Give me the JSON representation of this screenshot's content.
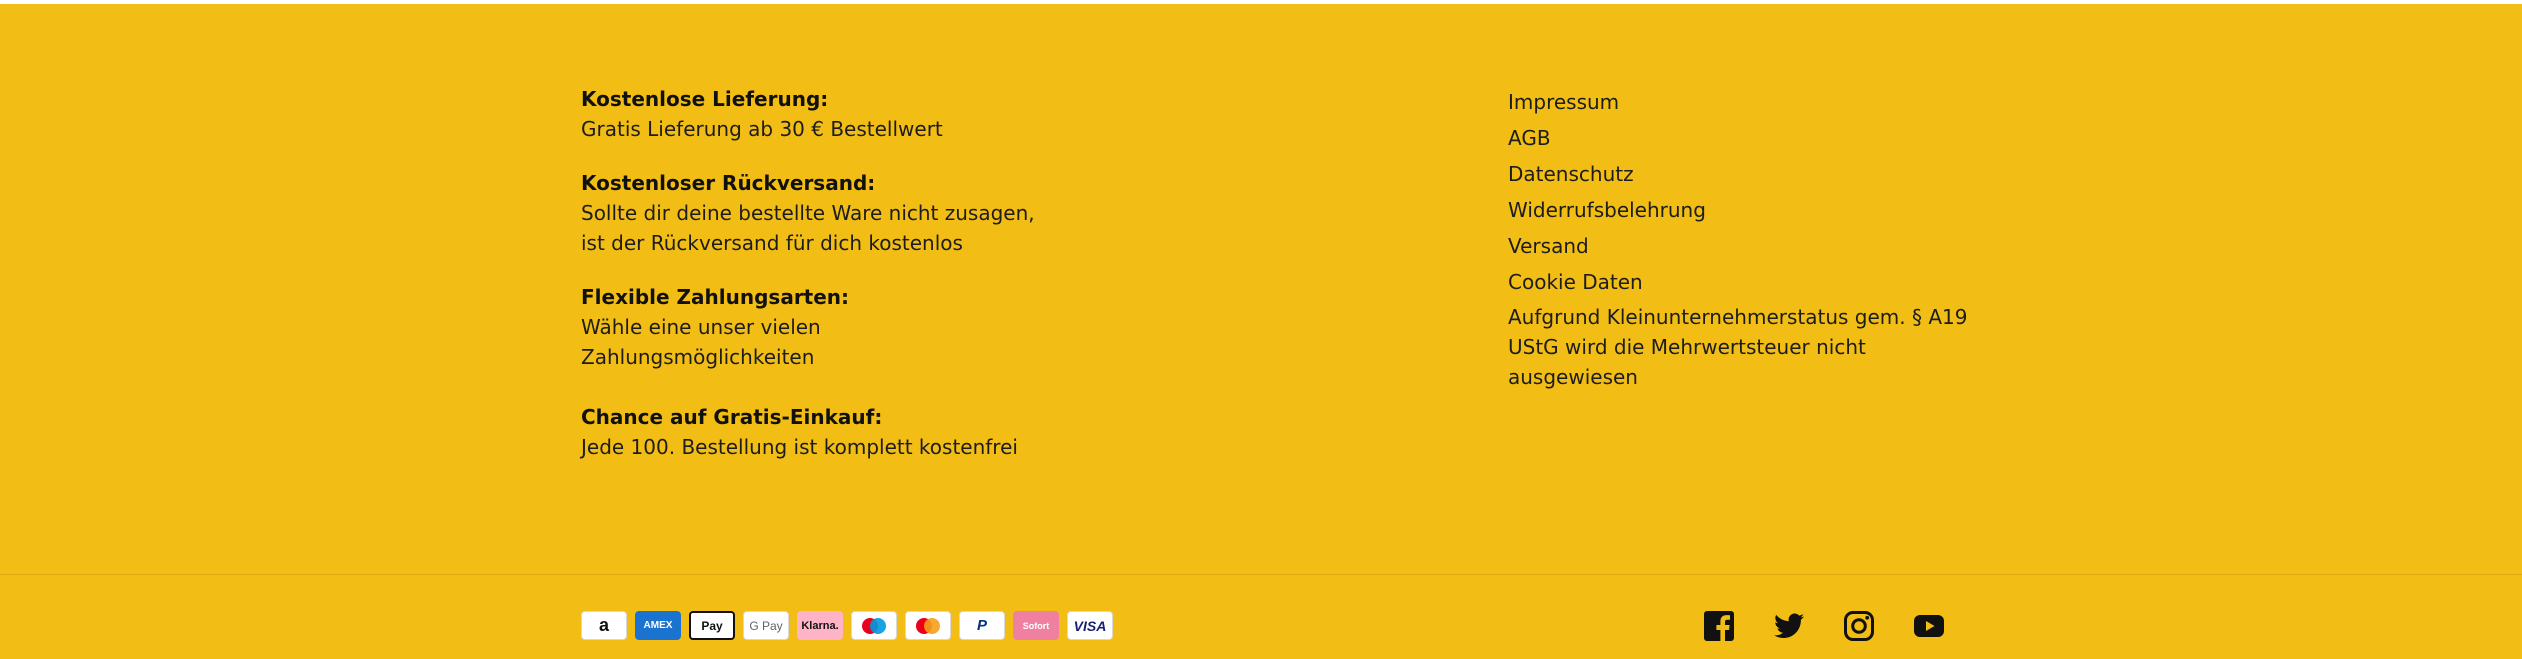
{
  "info": [
    {
      "title": "Kostenlose Lieferung:",
      "lines": [
        "Gratis Lieferung ab 30 € Bestellwert"
      ]
    },
    {
      "title": "Kostenloser Rückversand:",
      "lines": [
        "Sollte dir deine bestellte Ware nicht zusagen,",
        "ist der Rückversand für dich kostenlos"
      ]
    },
    {
      "title": "Flexible Zahlungsarten:",
      "lines": [
        "Wähle eine unser vielen",
        "Zahlungsmöglichkeiten"
      ]
    },
    {
      "title": "Chance auf Gratis-Einkauf:",
      "lines": [
        "Jede 100. Bestellung ist komplett kostenfrei"
      ]
    }
  ],
  "links": [
    "Impressum",
    "AGB",
    "Datenschutz",
    "Widerrufsbelehrung",
    "Versand",
    "Cookie Daten"
  ],
  "vat_note": "Aufgrund Kleinunternehmerstatus gem. § A19 UStG wird die Mehrwertsteuer nicht ausgewiesen",
  "payments": [
    {
      "icon": "amazon-pay-icon",
      "label": "a"
    },
    {
      "icon": "amex-icon",
      "label": "AMEX"
    },
    {
      "icon": "apple-pay-icon",
      "label": "Pay"
    },
    {
      "icon": "google-pay-icon",
      "label": "G Pay"
    },
    {
      "icon": "klarna-icon",
      "label": "Klarna."
    },
    {
      "icon": "maestro-icon",
      "label": ""
    },
    {
      "icon": "mastercard-icon",
      "label": ""
    },
    {
      "icon": "paypal-icon",
      "label": "P"
    },
    {
      "icon": "sofort-icon",
      "label": "Sofort"
    },
    {
      "icon": "visa-icon",
      "label": "VISA"
    }
  ],
  "social": [
    "facebook-icon",
    "twitter-icon",
    "instagram-icon",
    "youtube-icon"
  ],
  "colors": {
    "background": "#f2bd14",
    "text": "#1b1b1b"
  }
}
